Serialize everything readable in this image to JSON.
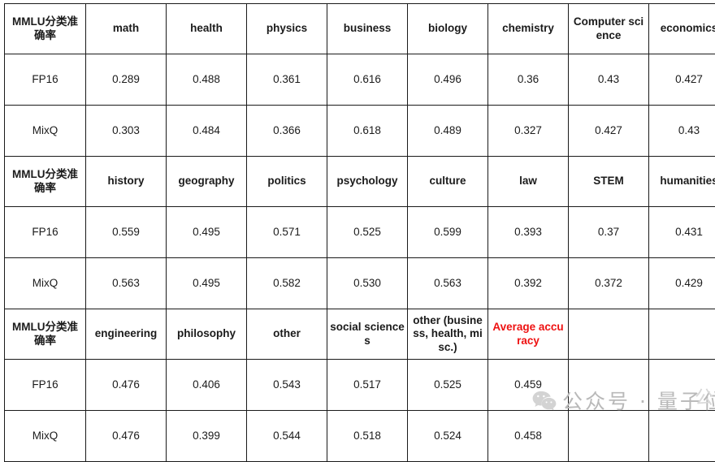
{
  "table": {
    "row_label_header": "MMLU分类准确率",
    "row_labels": [
      "FP16",
      "MixQ"
    ],
    "accent_color": "#ee1111",
    "blocks": [
      {
        "headers": [
          "MMLU分类准确率",
          "math",
          "health",
          "physics",
          "business",
          "biology",
          "chemistry",
          "Computer science",
          "economics"
        ],
        "rows": [
          {
            "label": "FP16",
            "values": [
              "0.289",
              "0.488",
              "0.361",
              "0.616",
              "0.496",
              "0.36",
              "0.43",
              "0.427"
            ]
          },
          {
            "label": "MixQ",
            "values": [
              "0.303",
              "0.484",
              "0.366",
              "0.618",
              "0.489",
              "0.327",
              "0.427",
              "0.43"
            ]
          }
        ]
      },
      {
        "headers": [
          "MMLU分类准确率",
          "history",
          "geography",
          "politics",
          "psychology",
          "culture",
          "law",
          "STEM",
          "humanities"
        ],
        "rows": [
          {
            "label": "FP16",
            "values": [
              "0.559",
              "0.495",
              "0.571",
              "0.525",
              "0.599",
              "0.393",
              "0.37",
              "0.431"
            ]
          },
          {
            "label": "MixQ",
            "values": [
              "0.563",
              "0.495",
              "0.582",
              "0.530",
              "0.563",
              "0.392",
              "0.372",
              "0.429"
            ]
          }
        ]
      },
      {
        "headers": [
          "MMLU分类准确率",
          "engineering",
          "philosophy",
          "other",
          "social sciences",
          "other (business, health, misc.)",
          "Average accuracy",
          "",
          ""
        ],
        "header_accent_index": 6,
        "rows": [
          {
            "label": "FP16",
            "values": [
              "0.476",
              "0.406",
              "0.543",
              "0.517",
              "0.525",
              "0.459",
              "",
              ""
            ],
            "accent_index": 6
          },
          {
            "label": "MixQ",
            "values": [
              "0.476",
              "0.399",
              "0.544",
              "0.518",
              "0.524",
              "0.458",
              "",
              ""
            ],
            "accent_index": 6
          }
        ]
      }
    ]
  },
  "watermark": {
    "logo": "wechat-icon",
    "text": "公众号 · 量子位",
    "corner_mark": "公"
  }
}
